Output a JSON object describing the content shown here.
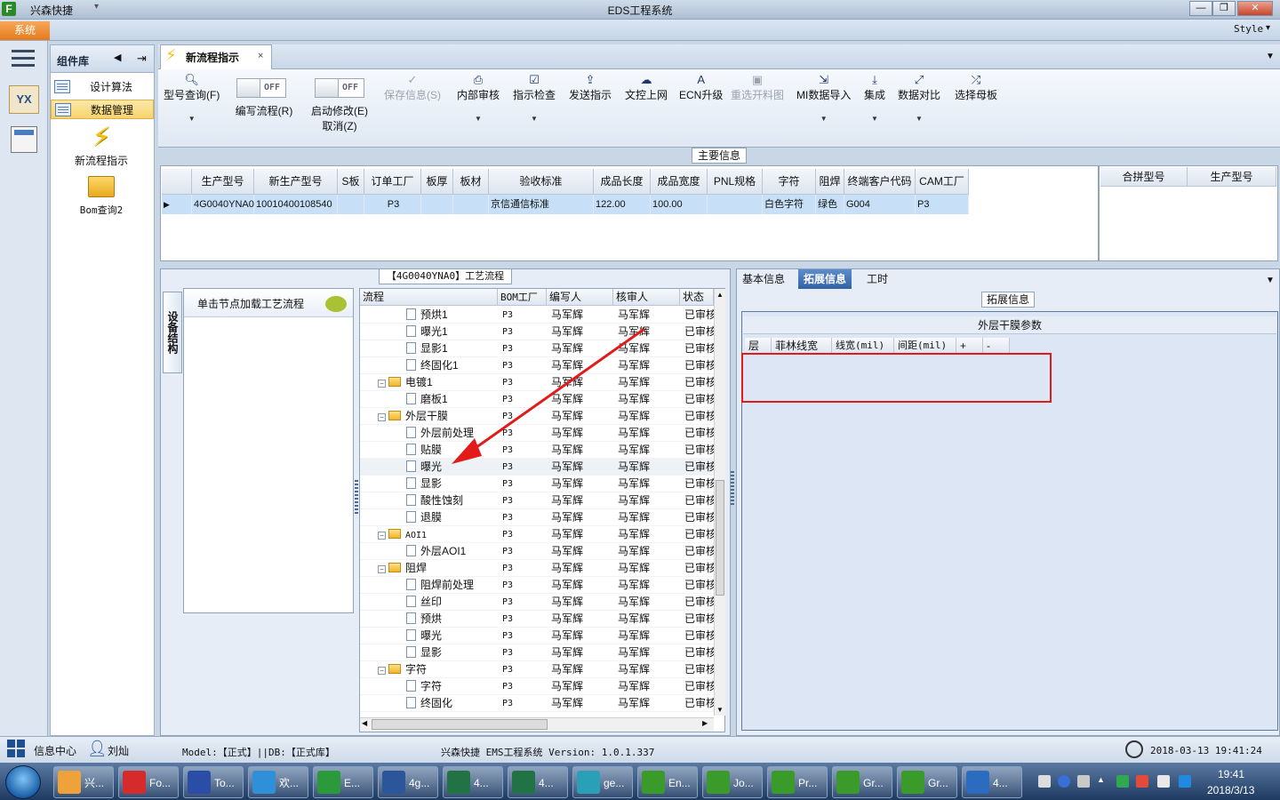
{
  "window": {
    "app_name": "兴森快捷",
    "title": "EDS工程系统",
    "style_label": "Style",
    "min": "—",
    "max": "❐",
    "close": "✕"
  },
  "menu": {
    "system_tab": "系统"
  },
  "component_library": {
    "title": "组件库",
    "items": [
      {
        "label": "设计算法",
        "selected": false
      },
      {
        "label": "数据管理",
        "selected": true
      }
    ],
    "big_items": [
      {
        "label": "新流程指示",
        "icon": "lightning-icon"
      },
      {
        "label": "Bom查询2",
        "icon": "folder-open-icon"
      }
    ]
  },
  "doc_tab": {
    "label": "新流程指示",
    "close": "×"
  },
  "toolbar": {
    "model_query": "型号查询(F)",
    "toggle_write": {
      "state": "OFF",
      "label": "编写流程(R)"
    },
    "toggle_modify": {
      "state": "OFF",
      "label1": "启动修改(E)",
      "label2": "取消(Z)"
    },
    "buttons": [
      {
        "label": "保存信息(S)",
        "disabled": true
      },
      {
        "label": "内部审核",
        "disabled": false
      },
      {
        "label": "指示检查",
        "disabled": false
      },
      {
        "label": "发送指示",
        "disabled": false
      },
      {
        "label": "文控上网",
        "disabled": false
      },
      {
        "label": "ECN升级",
        "disabled": false
      },
      {
        "label": "重选开料图",
        "disabled": true
      },
      {
        "label": "MI数据导入",
        "disabled": false
      },
      {
        "label": "集成",
        "disabled": false
      },
      {
        "label": "数据对比",
        "disabled": false
      },
      {
        "label": "选择母板",
        "disabled": false
      }
    ]
  },
  "main_info": {
    "title": "主要信息",
    "columns": [
      "生产型号",
      "新生产型号",
      "S板",
      "订单工厂",
      "板厚",
      "板材",
      "验收标准",
      "成品长度",
      "成品宽度",
      "PNL规格",
      "字符",
      "阻焊",
      "终端客户代码",
      "CAM工厂"
    ],
    "row": [
      "4G0040YNA0",
      "10010400108540",
      "",
      "P3",
      "",
      "",
      "京信通信标准",
      "122.00",
      "100.00",
      "",
      "白色字符",
      "绿色",
      "G004",
      "P3"
    ],
    "merge_columns": [
      "合拼型号",
      "生产型号"
    ]
  },
  "process": {
    "title": "【4G0040YNA0】工艺流程",
    "side_tab": "设备结构",
    "load_label": "单击节点加载工艺流程",
    "columns": [
      "流程",
      "BOM工厂",
      "编写人",
      "核审人",
      "状态"
    ],
    "rows": [
      {
        "name": "预烘1",
        "type": "doc",
        "level": 2,
        "bom": "P3",
        "writer": "马军辉",
        "reviewer": "马军辉",
        "status": "已审核"
      },
      {
        "name": "曝光1",
        "type": "doc",
        "level": 2,
        "bom": "P3",
        "writer": "马军辉",
        "reviewer": "马军辉",
        "status": "已审核"
      },
      {
        "name": "显影1",
        "type": "doc",
        "level": 2,
        "bom": "P3",
        "writer": "马军辉",
        "reviewer": "马军辉",
        "status": "已审核"
      },
      {
        "name": "终固化1",
        "type": "doc",
        "level": 2,
        "bom": "P3",
        "writer": "马军辉",
        "reviewer": "马军辉",
        "status": "已审核"
      },
      {
        "name": "电镀1",
        "type": "folder",
        "level": 1,
        "bom": "P3",
        "writer": "马军辉",
        "reviewer": "马军辉",
        "status": "已审核"
      },
      {
        "name": "磨板1",
        "type": "doc",
        "level": 2,
        "bom": "P3",
        "writer": "马军辉",
        "reviewer": "马军辉",
        "status": "已审核"
      },
      {
        "name": "外层干膜",
        "type": "folder",
        "level": 1,
        "bom": "P3",
        "writer": "马军辉",
        "reviewer": "马军辉",
        "status": "已审核"
      },
      {
        "name": "外层前处理",
        "type": "doc",
        "level": 2,
        "bom": "P3",
        "writer": "马军辉",
        "reviewer": "马军辉",
        "status": "已审核"
      },
      {
        "name": "贴膜",
        "type": "doc",
        "level": 2,
        "bom": "P3",
        "writer": "马军辉",
        "reviewer": "马军辉",
        "status": "已审核"
      },
      {
        "name": "曝光",
        "type": "doc",
        "level": 2,
        "bom": "P3",
        "writer": "马军辉",
        "reviewer": "马军辉",
        "status": "已审核",
        "selected": true
      },
      {
        "name": "显影",
        "type": "doc",
        "level": 2,
        "bom": "P3",
        "writer": "马军辉",
        "reviewer": "马军辉",
        "status": "已审核"
      },
      {
        "name": "酸性蚀刻",
        "type": "doc",
        "level": 2,
        "bom": "P3",
        "writer": "马军辉",
        "reviewer": "马军辉",
        "status": "已审核"
      },
      {
        "name": "退膜",
        "type": "doc",
        "level": 2,
        "bom": "P3",
        "writer": "马军辉",
        "reviewer": "马军辉",
        "status": "已审核"
      },
      {
        "name": "AOI1",
        "type": "folder",
        "level": 1,
        "bom": "P3",
        "writer": "马军辉",
        "reviewer": "马军辉",
        "status": "已审核"
      },
      {
        "name": "外层AOI1",
        "type": "doc",
        "level": 2,
        "bom": "P3",
        "writer": "马军辉",
        "reviewer": "马军辉",
        "status": "已审核"
      },
      {
        "name": "阻焊",
        "type": "folder",
        "level": 1,
        "bom": "P3",
        "writer": "马军辉",
        "reviewer": "马军辉",
        "status": "已审核"
      },
      {
        "name": "阻焊前处理",
        "type": "doc",
        "level": 2,
        "bom": "P3",
        "writer": "马军辉",
        "reviewer": "马军辉",
        "status": "已审核"
      },
      {
        "name": "丝印",
        "type": "doc",
        "level": 2,
        "bom": "P3",
        "writer": "马军辉",
        "reviewer": "马军辉",
        "status": "已审核"
      },
      {
        "name": "预烘",
        "type": "doc",
        "level": 2,
        "bom": "P3",
        "writer": "马军辉",
        "reviewer": "马军辉",
        "status": "已审核"
      },
      {
        "name": "曝光",
        "type": "doc",
        "level": 2,
        "bom": "P3",
        "writer": "马军辉",
        "reviewer": "马军辉",
        "status": "已审核"
      },
      {
        "name": "显影",
        "type": "doc",
        "level": 2,
        "bom": "P3",
        "writer": "马军辉",
        "reviewer": "马军辉",
        "status": "已审核"
      },
      {
        "name": "字符",
        "type": "folder",
        "level": 1,
        "bom": "P3",
        "writer": "马军辉",
        "reviewer": "马军辉",
        "status": "已审核"
      },
      {
        "name": "字符",
        "type": "doc",
        "level": 2,
        "bom": "P3",
        "writer": "马军辉",
        "reviewer": "马军辉",
        "status": "已审核"
      },
      {
        "name": "终固化",
        "type": "doc",
        "level": 2,
        "bom": "P3",
        "writer": "马军辉",
        "reviewer": "马军辉",
        "status": "已审核"
      }
    ]
  },
  "right_panel": {
    "tabs": [
      {
        "label": "基本信息",
        "selected": false
      },
      {
        "label": "拓展信息",
        "selected": true
      },
      {
        "label": "工时",
        "selected": false
      }
    ],
    "ext_title": "拓展信息",
    "film_title": "外层干膜参数",
    "film_columns": [
      "层",
      "菲林线宽",
      "线宽(mil)",
      "间距(mil)",
      "+",
      "-"
    ]
  },
  "status_bar": {
    "info_center": "信息中心",
    "user": "刘灿",
    "env": "Model:【正式】||DB:【正式库】",
    "system": "兴森快捷 EMS工程系统 Version: 1.0.1.337",
    "datetime": "2018-03-13 19:41:24"
  },
  "taskbar": {
    "tasks": [
      {
        "label": "兴...",
        "color": "#f0a23a"
      },
      {
        "label": "Fo...",
        "color": "#d62b2b"
      },
      {
        "label": "To...",
        "color": "#2a4ea8"
      },
      {
        "label": "欢...",
        "color": "#2f8fd8"
      },
      {
        "label": "E...",
        "color": "#2a9a3a"
      },
      {
        "label": "4g...",
        "color": "#2b579a"
      },
      {
        "label": "4...",
        "color": "#217346"
      },
      {
        "label": "4...",
        "color": "#217346"
      },
      {
        "label": "ge...",
        "color": "#2aa0b8"
      },
      {
        "label": "En...",
        "color": "#3a9a2a"
      },
      {
        "label": "Jo...",
        "color": "#3a9a2a"
      },
      {
        "label": "Pr...",
        "color": "#3a9a2a"
      },
      {
        "label": "Gr...",
        "color": "#3a9a2a"
      },
      {
        "label": "Gr...",
        "color": "#3a9a2a"
      },
      {
        "label": "4...",
        "color": "#2b6bc0"
      }
    ],
    "clock_time": "19:41",
    "clock_date": "2018/3/13"
  }
}
